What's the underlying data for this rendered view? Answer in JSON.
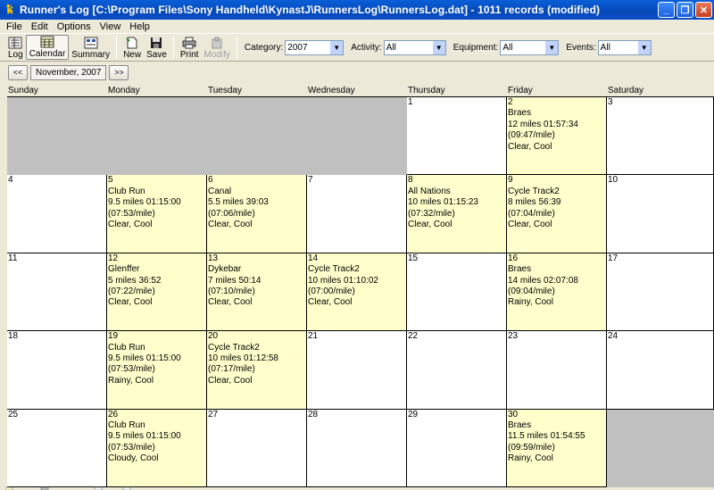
{
  "window": {
    "title": "Runner's Log [C:\\Program Files\\Sony Handheld\\KynastJ\\RunnersLog\\RunnersLog.dat] - 1011 records (modified)",
    "minimize_glyph": "_",
    "maximize_glyph": "❐",
    "close_glyph": "✕"
  },
  "menu": [
    "File",
    "Edit",
    "Options",
    "View",
    "Help"
  ],
  "toolbar": {
    "log": "Log",
    "calendar": "Calendar",
    "summary": "Summary",
    "new": "New",
    "save": "Save",
    "print": "Print",
    "modify": "Modify"
  },
  "filters": {
    "category_label": "Category:",
    "category_value": "2007",
    "activity_label": "Activity:",
    "activity_value": "All",
    "equipment_label": "Equipment:",
    "equipment_value": "All",
    "events_label": "Events:",
    "events_value": "All"
  },
  "nav": {
    "prev": "<<",
    "month": "November, 2007",
    "next": ">>"
  },
  "weekdays": [
    "Sunday",
    "Monday",
    "Tuesday",
    "Wednesday",
    "Thursday",
    "Friday",
    "Saturday"
  ],
  "days": [
    {
      "num": "",
      "lines": [],
      "state": "empty"
    },
    {
      "num": "",
      "lines": [],
      "state": "empty"
    },
    {
      "num": "",
      "lines": [],
      "state": "empty"
    },
    {
      "num": "",
      "lines": [],
      "state": "empty"
    },
    {
      "num": "1",
      "lines": [],
      "state": "plain"
    },
    {
      "num": "2",
      "lines": [
        "Braes",
        "12 miles 01:57:34",
        "(09:47/mile)",
        "Clear, Cool"
      ],
      "state": "run"
    },
    {
      "num": "3",
      "lines": [],
      "state": "plain"
    },
    {
      "num": "4",
      "lines": [],
      "state": "plain"
    },
    {
      "num": "5",
      "lines": [
        "Club Run",
        "9.5 miles 01:15:00",
        "(07:53/mile)",
        "Clear, Cool"
      ],
      "state": "run"
    },
    {
      "num": "6",
      "lines": [
        "Canal",
        "5.5 miles 39:03",
        "(07:06/mile)",
        "Clear, Cool"
      ],
      "state": "run"
    },
    {
      "num": "7",
      "lines": [],
      "state": "plain"
    },
    {
      "num": "8",
      "lines": [
        "All Nations",
        "10 miles 01:15:23",
        "(07:32/mile)",
        "Clear, Cool"
      ],
      "state": "run"
    },
    {
      "num": "9",
      "lines": [
        "Cycle Track2",
        "8 miles 56:39",
        "(07:04/mile)",
        "Clear, Cool"
      ],
      "state": "run"
    },
    {
      "num": "10",
      "lines": [],
      "state": "plain"
    },
    {
      "num": "11",
      "lines": [],
      "state": "plain"
    },
    {
      "num": "12",
      "lines": [
        "Glenffer",
        "5 miles 36:52",
        "(07:22/mile)",
        "Clear, Cool"
      ],
      "state": "run"
    },
    {
      "num": "13",
      "lines": [
        "Dykebar",
        "7 miles 50:14",
        "(07:10/mile)",
        "Clear, Cool"
      ],
      "state": "run"
    },
    {
      "num": "14",
      "lines": [
        "Cycle Track2",
        "10 miles 01:10:02",
        "(07:00/mile)",
        "Clear, Cool"
      ],
      "state": "run"
    },
    {
      "num": "15",
      "lines": [],
      "state": "plain"
    },
    {
      "num": "16",
      "lines": [
        "Braes",
        "14 miles 02:07:08",
        "(09:04/mile)",
        "Rainy, Cool"
      ],
      "state": "run"
    },
    {
      "num": "17",
      "lines": [],
      "state": "plain"
    },
    {
      "num": "18",
      "lines": [],
      "state": "plain"
    },
    {
      "num": "19",
      "lines": [
        "Club Run",
        "9.5 miles 01:15:00",
        "(07:53/mile)",
        "Rainy, Cool"
      ],
      "state": "run"
    },
    {
      "num": "20",
      "lines": [
        "Cycle Track2",
        "10 miles 01:12:58",
        "(07:17/mile)",
        "Clear, Cool"
      ],
      "state": "run"
    },
    {
      "num": "21",
      "lines": [],
      "state": "plain"
    },
    {
      "num": "22",
      "lines": [],
      "state": "plain"
    },
    {
      "num": "23",
      "lines": [],
      "state": "plain"
    },
    {
      "num": "24",
      "lines": [],
      "state": "plain"
    },
    {
      "num": "25",
      "lines": [],
      "state": "plain"
    },
    {
      "num": "26",
      "lines": [
        "Club Run",
        "9.5 miles 01:15:00",
        "(07:53/mile)",
        "Cloudy, Cool"
      ],
      "state": "run"
    },
    {
      "num": "27",
      "lines": [],
      "state": "plain"
    },
    {
      "num": "28",
      "lines": [],
      "state": "plain"
    },
    {
      "num": "29",
      "lines": [],
      "state": "plain"
    },
    {
      "num": "30",
      "lines": [
        "Braes",
        "11.5 miles 01:54:55",
        "(09:59/mile)",
        "Rainy, Cool"
      ],
      "state": "run"
    },
    {
      "num": "",
      "lines": [],
      "state": "empty"
    }
  ],
  "colors": {
    "run_day": "#FFFFCC",
    "empty_day": "#C0C0C0",
    "titlebar": "#0548B8"
  }
}
